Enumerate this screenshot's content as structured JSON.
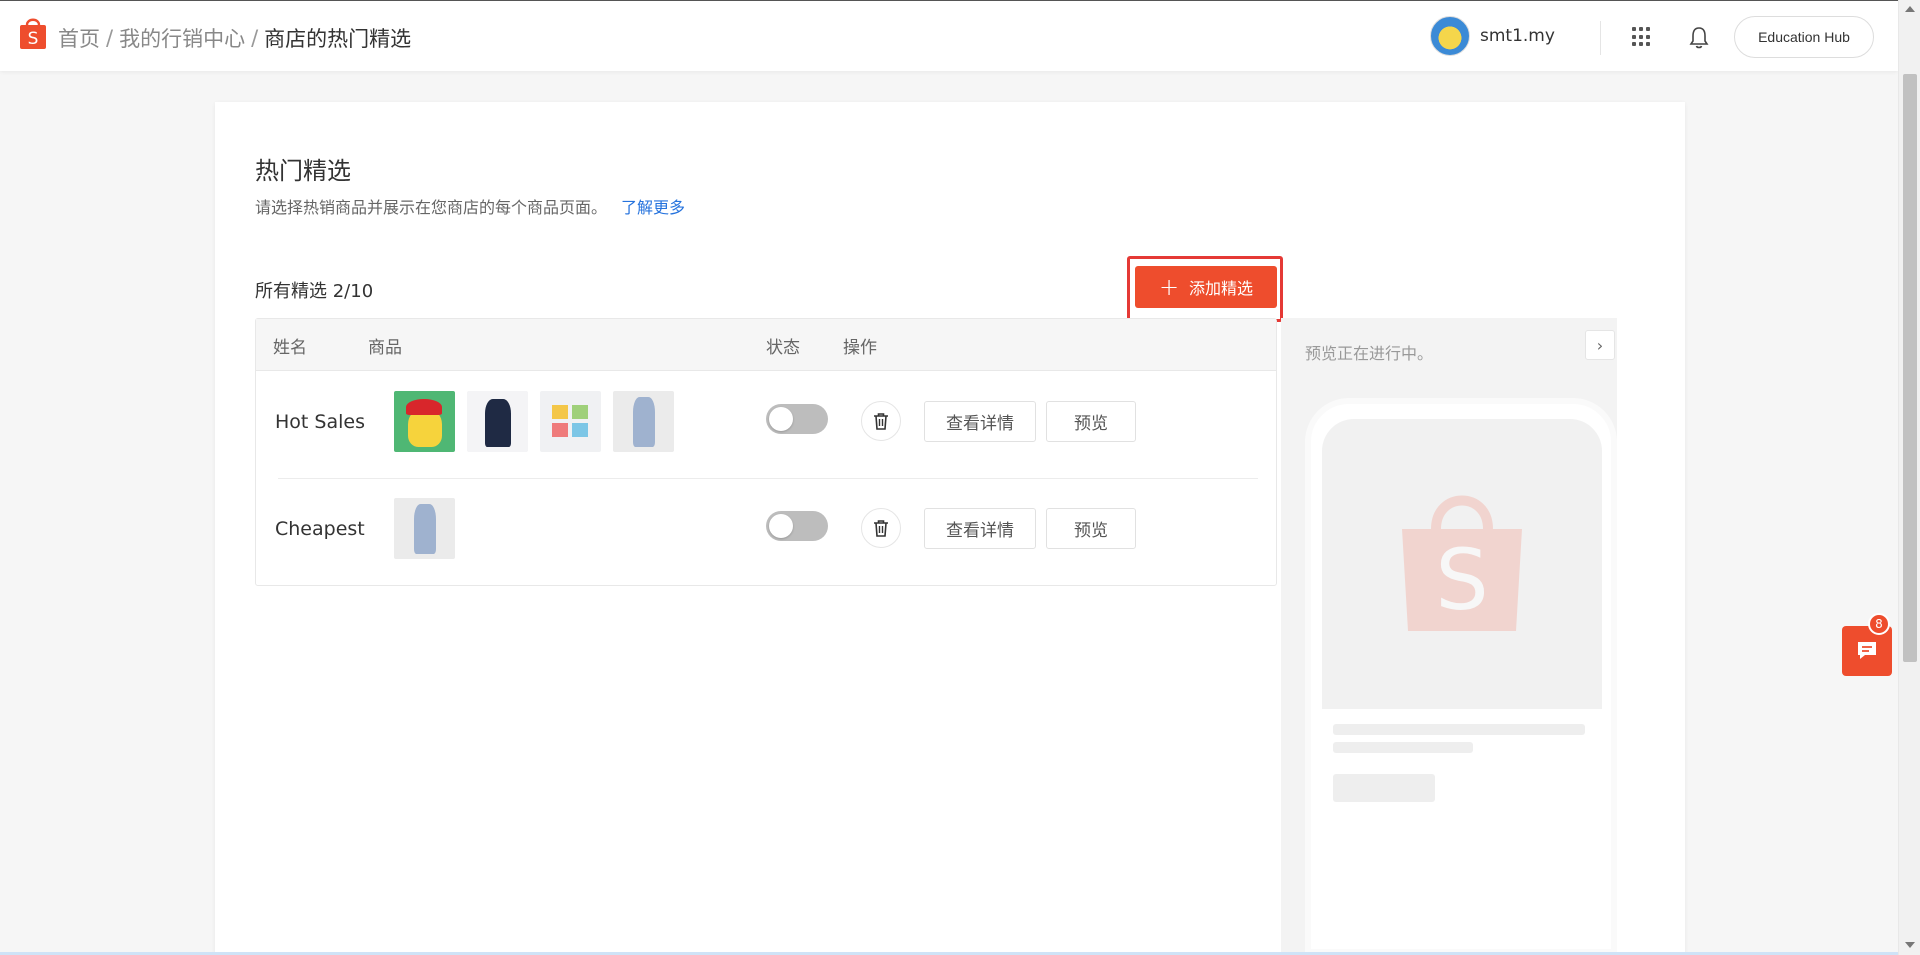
{
  "header": {
    "breadcrumb": [
      "首页",
      "我的行销中心",
      "商店的热门精选"
    ],
    "separator": "/",
    "username": "smt1.my",
    "education_hub_label": "Education Hub",
    "icons": [
      "shopee-logo-icon",
      "apps-grid-icon",
      "bell-icon"
    ]
  },
  "main": {
    "title": "热门精选",
    "description": "请选择热销商品并展示在您商店的每个商品页面。",
    "learn_more": "了解更多",
    "count_label": "所有精选 2/10",
    "add_button": "添加精选",
    "table": {
      "headers": [
        "姓名",
        "商品",
        "状态",
        "操作"
      ],
      "rows": [
        {
          "name": "Hot Sales",
          "products": [
            "pikachu-plush",
            "navy-dress",
            "sticky-notes",
            "striped-dress"
          ],
          "status_on": false,
          "detail_label": "查看详情",
          "preview_label": "预览"
        },
        {
          "name": "Cheapest",
          "products": [
            "striped-dress"
          ],
          "status_on": false,
          "detail_label": "查看详情",
          "preview_label": "预览"
        }
      ]
    }
  },
  "preview": {
    "status_text": "预览正在进行中。",
    "next_icon": "›"
  },
  "chat": {
    "badge_count": "8"
  },
  "colors": {
    "brand": "#ee4d2d",
    "link": "#2673dd",
    "highlight_border": "#e53935"
  }
}
